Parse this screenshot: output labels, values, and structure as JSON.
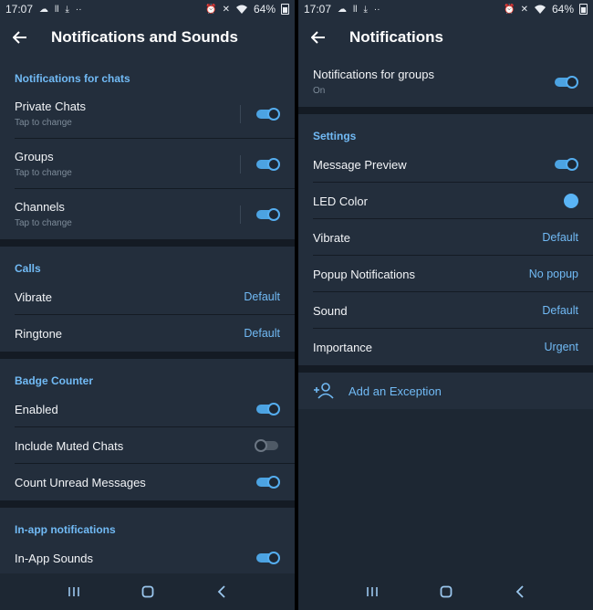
{
  "colors": {
    "accent": "#71baf5",
    "toggle_on": "#4ca3e2",
    "led_color": "#5ab4f5",
    "background": "#1d2733",
    "section_bg": "#232e3c"
  },
  "status_bar": {
    "time": "17:07",
    "battery": "64%"
  },
  "left_screen": {
    "title": "Notifications and Sounds",
    "sections": {
      "chats": {
        "title": "Notifications for chats",
        "items": [
          {
            "label": "Private Chats",
            "subtitle": "Tap to change",
            "enabled": true
          },
          {
            "label": "Groups",
            "subtitle": "Tap to change",
            "enabled": true
          },
          {
            "label": "Channels",
            "subtitle": "Tap to change",
            "enabled": true
          }
        ]
      },
      "calls": {
        "title": "Calls",
        "items": [
          {
            "label": "Vibrate",
            "value": "Default"
          },
          {
            "label": "Ringtone",
            "value": "Default"
          }
        ]
      },
      "badge": {
        "title": "Badge Counter",
        "items": [
          {
            "label": "Enabled",
            "enabled": true
          },
          {
            "label": "Include Muted Chats",
            "enabled": false
          },
          {
            "label": "Count Unread Messages",
            "enabled": true
          }
        ]
      },
      "inapp": {
        "title": "In-app notifications",
        "items": [
          {
            "label": "In-App Sounds",
            "enabled": true
          }
        ]
      }
    }
  },
  "right_screen": {
    "title": "Notifications",
    "groups_toggle": {
      "label": "Notifications for groups",
      "subtitle": "On",
      "enabled": true
    },
    "settings": {
      "title": "Settings",
      "message_preview": {
        "label": "Message Preview",
        "enabled": true
      },
      "led_color": {
        "label": "LED Color"
      },
      "vibrate": {
        "label": "Vibrate",
        "value": "Default"
      },
      "popup": {
        "label": "Popup Notifications",
        "value": "No popup"
      },
      "sound": {
        "label": "Sound",
        "value": "Default"
      },
      "importance": {
        "label": "Importance",
        "value": "Urgent"
      }
    },
    "exception": {
      "label": "Add an Exception"
    }
  },
  "icons": {
    "status_left": [
      "cloud-icon",
      "signal-bars-icon",
      "download-icon",
      "more-dots-icon"
    ],
    "status_right": [
      "alarm-icon",
      "mute-icon",
      "wifi-icon",
      "battery-icon"
    ],
    "nav": [
      "recents-icon",
      "home-icon",
      "back-nav-icon"
    ],
    "exception": "add-user-icon"
  }
}
